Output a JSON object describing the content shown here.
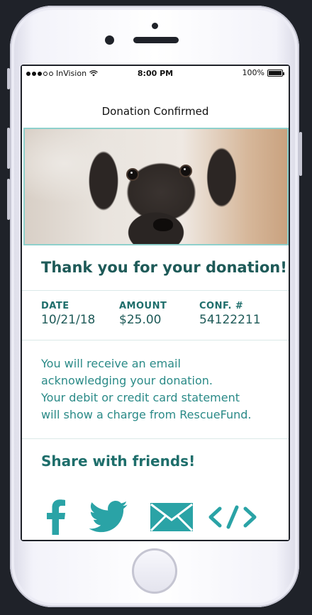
{
  "status_bar": {
    "carrier": "InVision",
    "time": "8:00 PM",
    "battery": "100%"
  },
  "header": {
    "title": "Donation Confirmed"
  },
  "hero": {
    "image": "puppy-photo"
  },
  "thanks": {
    "heading": "Thank you for your donation!"
  },
  "details": {
    "date_label": "DATE",
    "date_value": "10/21/18",
    "amount_label": "AMOUNT",
    "amount_value": "$25.00",
    "conf_label": "CONF. #",
    "conf_value": "54122211"
  },
  "message": {
    "line1": "You will receive an email",
    "line2": "acknowledging your donation.",
    "line3": "Your debit or credit card statement",
    "line4": "will show a charge from RescueFund."
  },
  "share": {
    "heading": "Share with friends!",
    "icons": [
      "facebook-icon",
      "twitter-icon",
      "email-icon",
      "embed-code-icon"
    ]
  },
  "colors": {
    "accent": "#2aa3a6",
    "heading": "#1e5a58",
    "border": "#8ed0cc"
  }
}
